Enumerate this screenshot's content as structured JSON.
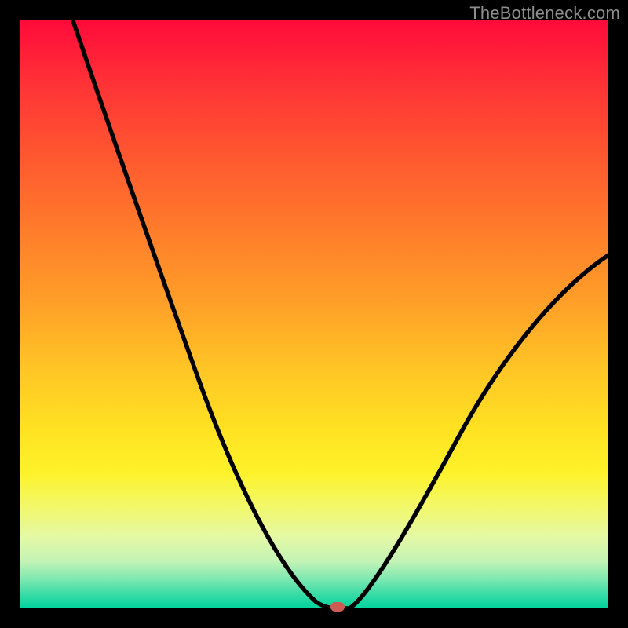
{
  "watermark": {
    "text": "TheBottleneck.com"
  },
  "colors": {
    "frame_bg": "#000000",
    "curve_stroke": "#000000",
    "marker_fill": "#cc5b54",
    "gradient_stops": [
      {
        "pct": 0,
        "hex": "#ff0a3a"
      },
      {
        "pct": 10,
        "hex": "#ff2f37"
      },
      {
        "pct": 22,
        "hex": "#ff5430"
      },
      {
        "pct": 35,
        "hex": "#ff7a2b"
      },
      {
        "pct": 48,
        "hex": "#ff9f28"
      },
      {
        "pct": 60,
        "hex": "#ffc725"
      },
      {
        "pct": 70,
        "hex": "#ffe322"
      },
      {
        "pct": 77,
        "hex": "#fdf22a"
      },
      {
        "pct": 83,
        "hex": "#f2f86d"
      },
      {
        "pct": 88,
        "hex": "#e3f9a6"
      },
      {
        "pct": 92,
        "hex": "#c3f3b5"
      },
      {
        "pct": 95,
        "hex": "#7fe8b1"
      },
      {
        "pct": 97.5,
        "hex": "#3bdca7"
      },
      {
        "pct": 100,
        "hex": "#00d39e"
      }
    ]
  },
  "chart_data": {
    "type": "line",
    "title": "",
    "xlabel": "",
    "ylabel": "",
    "xlim": [
      0,
      100
    ],
    "ylim": [
      0,
      100
    ],
    "marker": {
      "x": 54,
      "y": 0
    },
    "series": [
      {
        "name": "left-branch",
        "x": [
          9,
          12,
          16,
          20,
          24,
          28,
          32,
          36,
          40,
          44,
          47,
          50,
          52,
          54
        ],
        "y": [
          100,
          91,
          80,
          69,
          59,
          49,
          40,
          32,
          24,
          16,
          10,
          5,
          1.5,
          0
        ]
      },
      {
        "name": "floor",
        "x": [
          52,
          56
        ],
        "y": [
          0,
          0
        ]
      },
      {
        "name": "right-branch",
        "x": [
          56,
          60,
          64,
          68,
          72,
          76,
          80,
          84,
          88,
          92,
          96,
          100
        ],
        "y": [
          0,
          4,
          9,
          14,
          20,
          26,
          32,
          38,
          44,
          50,
          55,
          60
        ]
      }
    ]
  }
}
